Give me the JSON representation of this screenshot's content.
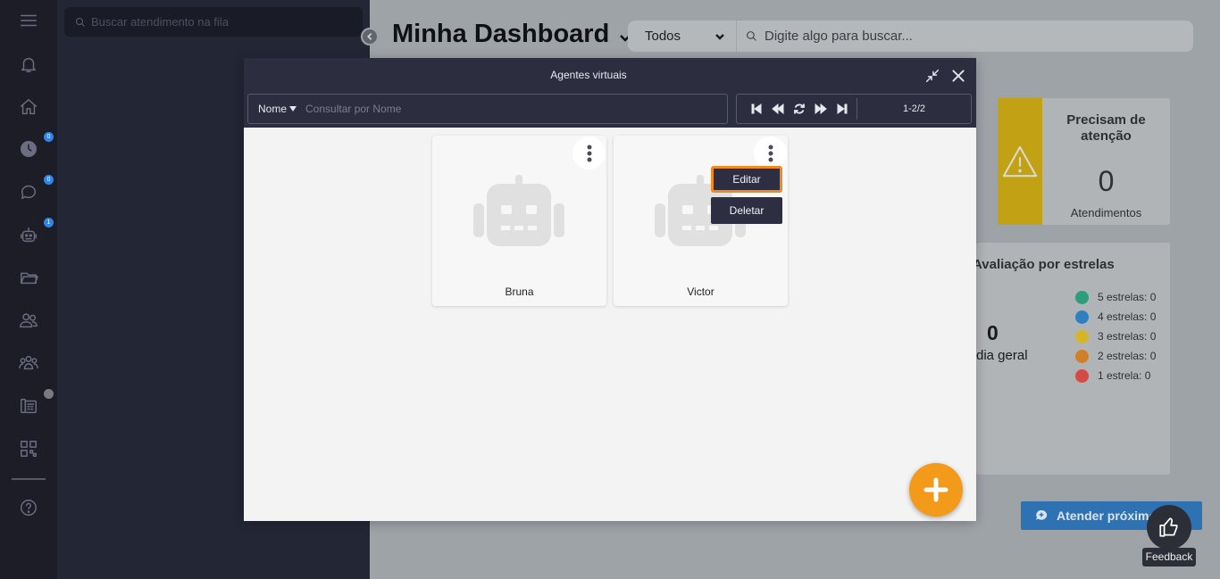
{
  "sidebar": {
    "items": [
      {
        "icon": "menu-icon"
      },
      {
        "icon": "bell-icon"
      },
      {
        "icon": "home-icon"
      },
      {
        "icon": "clock-icon",
        "badge": "0"
      },
      {
        "icon": "chat-icon",
        "badge": "0"
      },
      {
        "icon": "robot-icon",
        "badge": "1"
      },
      {
        "icon": "folder-icon"
      },
      {
        "icon": "users-icon"
      },
      {
        "icon": "team-icon"
      },
      {
        "icon": "phone-directory-icon"
      },
      {
        "icon": "qrcode-icon"
      },
      {
        "icon": "help-icon"
      }
    ]
  },
  "queue": {
    "search_placeholder": "Buscar atendimento na fila"
  },
  "dashboard": {
    "title": "Minha Dashboard",
    "filter": {
      "selected": "Todos",
      "search_placeholder": "Digite algo para buscar..."
    },
    "attention": {
      "title": "Precisam de atenção",
      "count": "0",
      "label": "Atendimentos"
    },
    "stars": {
      "title": "Avaliação por estrelas",
      "avg_value": "0",
      "avg_label": "dia geral",
      "legend": [
        {
          "label": "5 estrelas: 0",
          "color": "#2e9e7a"
        },
        {
          "label": "4 estrelas: 0",
          "color": "#2f7fc1"
        },
        {
          "label": "3 estrelas: 0",
          "color": "#d4b52a"
        },
        {
          "label": "2 estrelas: 0",
          "color": "#d27f2b"
        },
        {
          "label": "1 estrela: 0",
          "color": "#d64a45"
        }
      ]
    },
    "attend_next": "Atender próximo",
    "feedback": "Feedback"
  },
  "modal": {
    "title": "Agentes virtuais",
    "filter": {
      "field": "Nome",
      "placeholder": "Consultar por Nome"
    },
    "pagination": "1-2/2",
    "agents": [
      {
        "name": "Bruna"
      },
      {
        "name": "Victor"
      }
    ],
    "context_menu": {
      "edit": "Editar",
      "delete": "Deletar"
    }
  },
  "colors": {
    "accent": "#f39a1b",
    "modal_header": "#2c2d3f",
    "highlight": "#f08a1c"
  }
}
